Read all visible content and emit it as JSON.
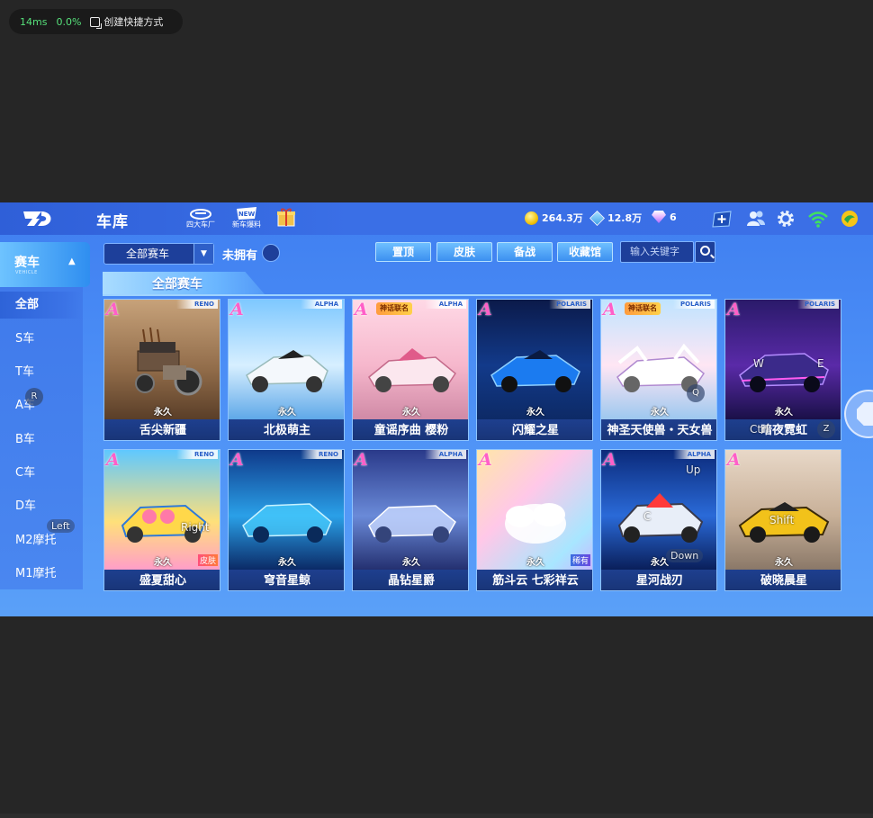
{
  "perf": {
    "latency": "14ms",
    "loss": "0.0%",
    "shortcut": "创建快捷方式"
  },
  "header": {
    "title": "车库",
    "icons": [
      {
        "name": "factory",
        "caption": "四大车厂"
      },
      {
        "name": "new-car",
        "caption": "新车爆料"
      },
      {
        "name": "gift",
        "caption": ""
      }
    ],
    "currency": {
      "coins": "264.3万",
      "tickets": "12.8万",
      "gems": "6"
    }
  },
  "sidebar": {
    "head_label": "赛车",
    "head_sub": "VEHICLE",
    "items": [
      {
        "label": "全部",
        "active": true
      },
      {
        "label": "S车",
        "active": false
      },
      {
        "label": "T车",
        "active": false
      },
      {
        "label": "A车",
        "active": false
      },
      {
        "label": "B车",
        "active": false
      },
      {
        "label": "C车",
        "active": false
      },
      {
        "label": "D车",
        "active": false
      },
      {
        "label": "M2摩托",
        "active": false
      },
      {
        "label": "M1摩托",
        "active": false
      }
    ]
  },
  "filters": {
    "select_value": "全部赛车",
    "unowned_label": "未拥有",
    "tabs": [
      "置顶",
      "皮肤",
      "备战",
      "收藏馆"
    ],
    "search_placeholder": "输入关键字"
  },
  "section_title": "全部赛车",
  "cards": [
    {
      "grade": "A",
      "brand": "RENO",
      "tag": "",
      "duration": "永久",
      "name": "舌尖新疆",
      "skin": ""
    },
    {
      "grade": "A",
      "brand": "ALPHA",
      "tag": "",
      "duration": "永久",
      "name": "北极萌主",
      "skin": ""
    },
    {
      "grade": "A",
      "brand": "ALPHA",
      "tag": "神话联名",
      "duration": "永久",
      "name": "童谣序曲 樱粉",
      "skin": ""
    },
    {
      "grade": "A",
      "brand": "POLARIS",
      "tag": "",
      "duration": "永久",
      "name": "闪耀之星",
      "skin": ""
    },
    {
      "grade": "A",
      "brand": "POLARIS",
      "tag": "神话联名",
      "duration": "永久",
      "name": "神圣天使兽・天女兽",
      "skin": ""
    },
    {
      "grade": "A",
      "brand": "POLARIS",
      "tag": "",
      "duration": "永久",
      "name": "暗夜霓虹",
      "skin": ""
    },
    {
      "grade": "A",
      "brand": "RENO",
      "tag": "",
      "duration": "永久",
      "name": "盛夏甜心",
      "skin": "皮肤"
    },
    {
      "grade": "A",
      "brand": "RENO",
      "tag": "",
      "duration": "永久",
      "name": "穹音星鲸",
      "skin": ""
    },
    {
      "grade": "A",
      "brand": "ALPHA",
      "tag": "",
      "duration": "永久",
      "name": "晶钻星爵",
      "skin": ""
    },
    {
      "grade": "A",
      "brand": "",
      "tag": "",
      "duration": "永久",
      "name": "筋斗云 七彩祥云",
      "skin": "稀有"
    },
    {
      "grade": "A",
      "brand": "ALPHA",
      "tag": "",
      "duration": "永久",
      "name": "星河战刃",
      "skin": ""
    },
    {
      "grade": "A",
      "brand": "",
      "tag": "",
      "duration": "永久",
      "name": "破晓晨星",
      "skin": ""
    }
  ],
  "key_hints": [
    "R",
    "Left",
    "Right",
    "Q",
    "W",
    "E",
    "Ctrl",
    "Z",
    "Up",
    "Down",
    "C",
    "Shift"
  ],
  "colors": {
    "accent": "#3f7ef0",
    "name_bar": "#1e3f8e",
    "grade": "#ff5fc8"
  }
}
